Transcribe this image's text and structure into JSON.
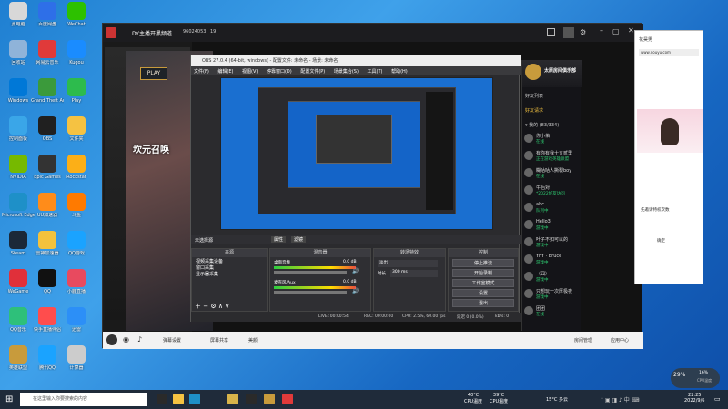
{
  "desktop": {
    "icons": [
      {
        "label": "此电脑",
        "color": "#d8d8d8"
      },
      {
        "label": "回收站",
        "color": "#8fb3d9"
      },
      {
        "label": "Windows",
        "color": "#0078d7"
      },
      {
        "label": "控制面板",
        "color": "#3aa6e8"
      },
      {
        "label": "NVIDIA",
        "color": "#76b900"
      },
      {
        "label": "Microsoft Edge",
        "color": "#1e90c8"
      },
      {
        "label": "Steam",
        "color": "#1b2838"
      },
      {
        "label": "WeGame",
        "color": "#e0303a"
      },
      {
        "label": "QQ音乐",
        "color": "#2ec07a"
      },
      {
        "label": "英雄联盟",
        "color": "#c89b3c"
      },
      {
        "label": "百度网盘",
        "color": "#2e6fe8"
      },
      {
        "label": "网易云音乐",
        "color": "#e03a3a"
      },
      {
        "label": "Grand Theft Auto V",
        "color": "#3b9a3b"
      },
      {
        "label": "OBS",
        "color": "#202020"
      },
      {
        "label": "Epic Games",
        "color": "#333"
      },
      {
        "label": "UU加速器",
        "color": "#ff8c1a"
      },
      {
        "label": "雷神加速器",
        "color": "#f3c23c"
      },
      {
        "label": "QQ",
        "color": "#111"
      },
      {
        "label": "快手直播伴侣",
        "color": "#ff4d4d"
      },
      {
        "label": "腾讯QQ",
        "color": "#1aa3ff"
      },
      {
        "label": "WeChat",
        "color": "#2dc100"
      },
      {
        "label": "Kugou",
        "color": "#1a8cff"
      },
      {
        "label": "Play",
        "color": "#2dbb4d"
      },
      {
        "label": "文件夹",
        "color": "#f5c242"
      },
      {
        "label": "Rockstar",
        "color": "#fcaf17"
      },
      {
        "label": "斗鱼",
        "color": "#ff7a00"
      },
      {
        "label": "QQ游戏",
        "color": "#1aa3ff"
      },
      {
        "label": "小鹿直播",
        "color": "#e84a5f"
      },
      {
        "label": "迅雷",
        "color": "#2c8ff7"
      },
      {
        "label": "计算器",
        "color": "#ccc"
      }
    ]
  },
  "app": {
    "title": "DY主播开黑频道",
    "room_id": "96024053",
    "viewers": "19",
    "game_banner_title": "坎元召唤",
    "play_label": "PLAY",
    "bottom_bar": {
      "items": [
        "弹幕设置",
        "屏幕共享",
        "美颜"
      ],
      "right_items": [
        "房间管理",
        "应用中心"
      ]
    }
  },
  "obs": {
    "title": "OBS 27.0.4 (64-bit, windows) - 配置文件: 未命名 - 场景: 未命名",
    "menu": [
      "文件(F)",
      "编辑(E)",
      "视图(V)",
      "停靠窗口(D)",
      "配置文件(P)",
      "场景集合(S)",
      "工具(T)",
      "帮助(H)"
    ],
    "scene_label": "未选择源",
    "props_label": "属性",
    "filter_label": "滤镜",
    "docks": {
      "sources": {
        "title": "来源",
        "items": [
          "视频采集设备",
          "窗口采集",
          "显示器采集"
        ]
      },
      "mixer": {
        "title": "混音器",
        "tracks": [
          {
            "name": "桌面音频",
            "db": "0.0 dB"
          },
          {
            "name": "麦克风/Aux",
            "db": "0.0 dB"
          }
        ]
      },
      "transitions": {
        "title": "转场特效",
        "type": "淡出",
        "duration_label": "时长",
        "duration": "300 ms"
      },
      "controls": {
        "title": "控制",
        "buttons": [
          "停止推流",
          "开始录制",
          "工作室模式",
          "设置",
          "退出"
        ]
      }
    },
    "status": {
      "live": "LIVE: 00:00:54",
      "rec": "REC: 00:00:00",
      "cpu": "CPU: 2.5%, 60.00 fps",
      "dropped": "延迟 0 (0.0%)",
      "kb": "kb/s: 0"
    }
  },
  "chat": {
    "channel_name": "太原房间俱乐部",
    "tab_label": "好友列表",
    "group_label": "好友请求",
    "online_label": "▾ 我的 (83/334)",
    "friends": [
      {
        "name": "你小佑",
        "status": "在线"
      },
      {
        "name": "有你有我十五贰里",
        "status": "正在游戏英雄联盟"
      },
      {
        "name": "糊咕咕人撕裂boy",
        "status": "在线"
      },
      {
        "name": "午后对",
        "status": "*2022好友访问"
      },
      {
        "name": "abc",
        "status": "队列中"
      },
      {
        "name": "Hello3",
        "status": "游戏中"
      },
      {
        "name": "叶子不如可以的",
        "status": "游戏中"
      },
      {
        "name": "YFY · Bruce",
        "status": "游戏中"
      },
      {
        "name": "（囧）",
        "status": "游戏中"
      },
      {
        "name": "只想玩一次厚极夜",
        "status": "游戏中"
      },
      {
        "name": "团团",
        "status": "在线"
      }
    ]
  },
  "right_window": {
    "title": "花昊男",
    "url": "www.douyu.com",
    "text1": "先邀请特权次数",
    "text2": "确定"
  },
  "widget": {
    "percent": "29%",
    "cpu_label": "16%",
    "cpu_sub": "CPU温度"
  },
  "taskbar": {
    "search_placeholder": "在这里输入你要搜索的内容",
    "weather": "15°C 多云",
    "cpu_temp": "40°C",
    "cpu_temp_label": "CPU温度",
    "gpu_temp": "39°C",
    "gpu_temp_label": "CPU温度",
    "time": "22:25",
    "date": "2022/9/6"
  }
}
